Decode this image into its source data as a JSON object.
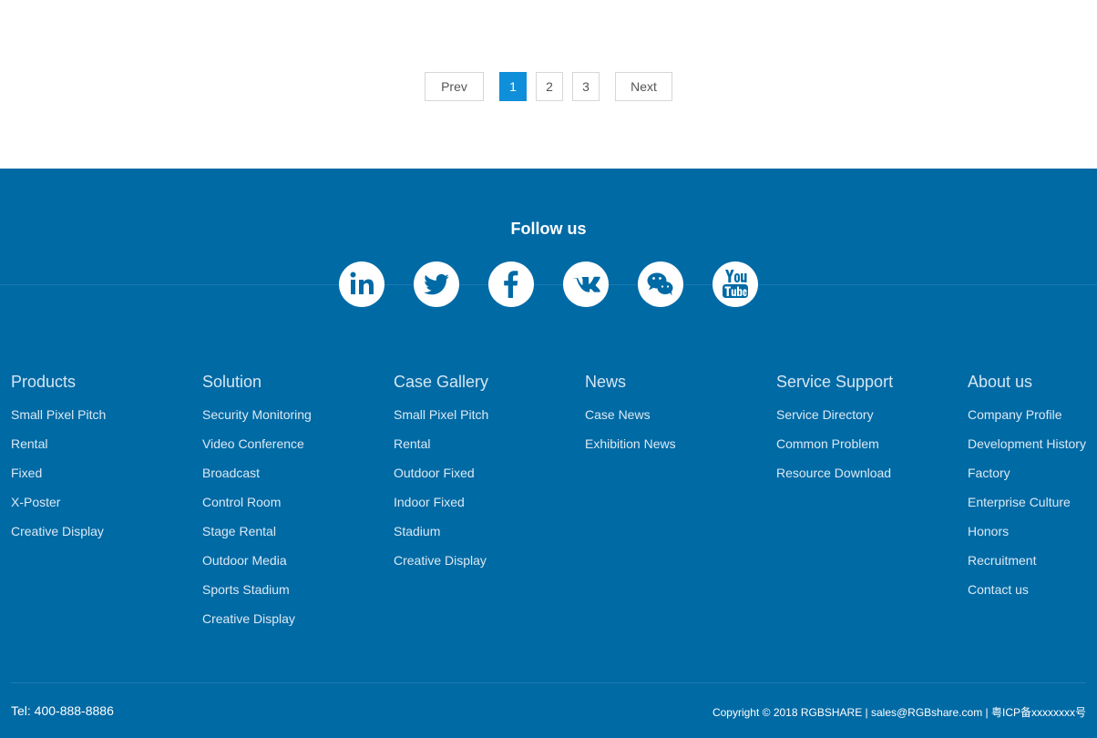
{
  "pagination": {
    "prev": "Prev",
    "pages": [
      "1",
      "2",
      "3"
    ],
    "current": "1",
    "next": "Next"
  },
  "footer": {
    "follow_title": "Follow us",
    "social": [
      "linkedin-icon",
      "twitter-icon",
      "facebook-icon",
      "vk-icon",
      "wechat-icon",
      "youtube-icon"
    ],
    "columns": [
      {
        "title": "Products",
        "items": [
          "Small Pixel Pitch",
          "Rental",
          "Fixed",
          "X-Poster",
          "Creative Display"
        ]
      },
      {
        "title": "Solution",
        "items": [
          "Security Monitoring",
          "Video Conference",
          "Broadcast",
          "Control Room",
          "Stage Rental",
          "Outdoor Media",
          "Sports Stadium",
          "Creative Display"
        ]
      },
      {
        "title": "Case Gallery",
        "items": [
          "Small Pixel Pitch",
          "Rental",
          "Outdoor Fixed",
          "Indoor Fixed",
          "Stadium",
          "Creative Display"
        ]
      },
      {
        "title": "News",
        "items": [
          "Case News",
          "Exhibition News"
        ]
      },
      {
        "title": "Service Support",
        "items": [
          "Service Directory",
          "Common Problem",
          "Resource Download"
        ]
      },
      {
        "title": "About us",
        "items": [
          "Company Profile",
          "Development History",
          "Factory",
          "Enterprise Culture",
          "Honors",
          "Recruitment",
          "Contact us"
        ]
      }
    ],
    "tel": "Tel: 400-888-8886",
    "copyright": "Copyright © 2018 RGBSHARE | sales@RGBshare.com | 粤ICP备xxxxxxxx号"
  },
  "colors": {
    "footer_bg": "#006aa5",
    "pager_active": "#0f8fd9"
  }
}
